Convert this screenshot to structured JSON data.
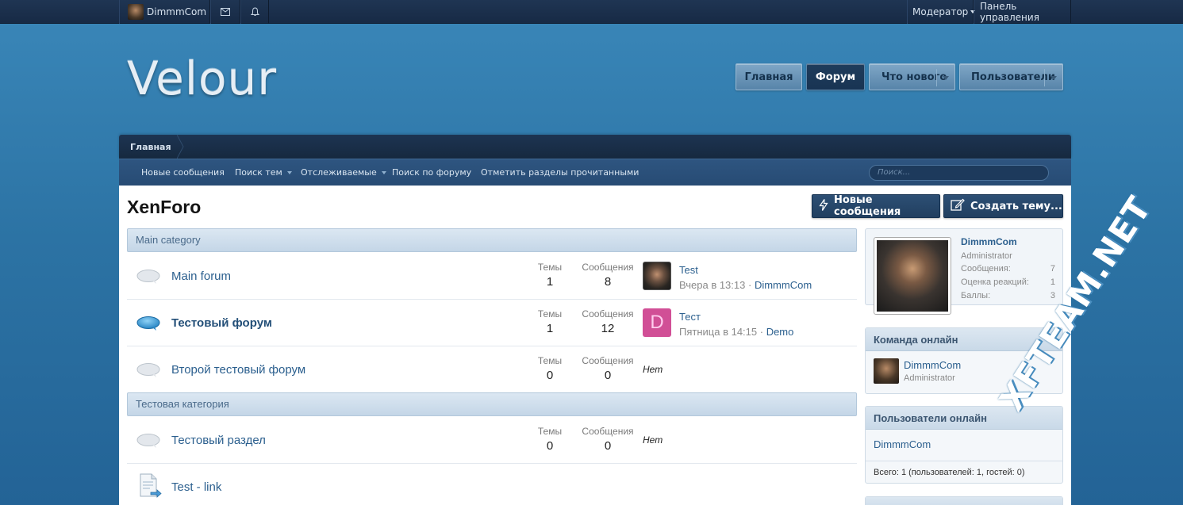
{
  "topbar": {
    "username": "DimmmCom",
    "moderator_label": "Модератор",
    "admin_panel_label": "Панель управления"
  },
  "logo": {
    "text": "Velour"
  },
  "nav": {
    "home": "Главная",
    "forum": "Форум",
    "whats_new": "Что нового",
    "users": "Пользователи"
  },
  "breadcrumb": {
    "home": "Главная"
  },
  "subnav": {
    "items": [
      "Новые сообщения",
      "Поиск тем",
      "Отслеживаемые",
      "Поиск по форуму",
      "Отметить разделы прочитанными"
    ],
    "search_placeholder": "Поиск..."
  },
  "page": {
    "title": "XenForo",
    "btn_new_posts": "Новые сообщения",
    "btn_create_thread": "Создать тему..."
  },
  "stat_labels": {
    "themes": "Темы",
    "posts": "Сообщения"
  },
  "categories": [
    {
      "title": "Main category",
      "forums": [
        {
          "name": "Main forum",
          "themes": "1",
          "posts": "8",
          "last_title": "Test",
          "last_date": "Вчера в 13:13",
          "last_user": "DimmmCom",
          "unread": false
        },
        {
          "name": "Тестовый форум",
          "themes": "1",
          "posts": "12",
          "last_title": "Тест",
          "last_date": "Пятница в 14:15",
          "last_user": "Demo",
          "last_avatar_letter": "D",
          "unread": true
        },
        {
          "name": "Второй тестовый форум",
          "themes": "0",
          "posts": "0",
          "last_none": "Нет",
          "unread": false
        }
      ]
    },
    {
      "title": "Тестовая категория",
      "forums": [
        {
          "name": "Тестовый раздел",
          "themes": "0",
          "posts": "0",
          "last_none": "Нет",
          "unread": false
        },
        {
          "name": "Test - link",
          "type": "link"
        }
      ]
    }
  ],
  "sidebar": {
    "profile": {
      "name": "DimmmCom",
      "role": "Administrator",
      "stats": [
        {
          "label": "Сообщения:",
          "value": "7"
        },
        {
          "label": "Оценка реакций:",
          "value": "1"
        },
        {
          "label": "Баллы:",
          "value": "3"
        }
      ]
    },
    "staff": {
      "title": "Команда онлайн",
      "name": "DimmmCom",
      "role": "Administrator"
    },
    "online": {
      "title": "Пользователи онлайн",
      "name": "DimmmCom",
      "total": "Всего: 1 (пользователей: 1, гостей: 0)"
    }
  },
  "watermark": "XFTEAM.NET"
}
